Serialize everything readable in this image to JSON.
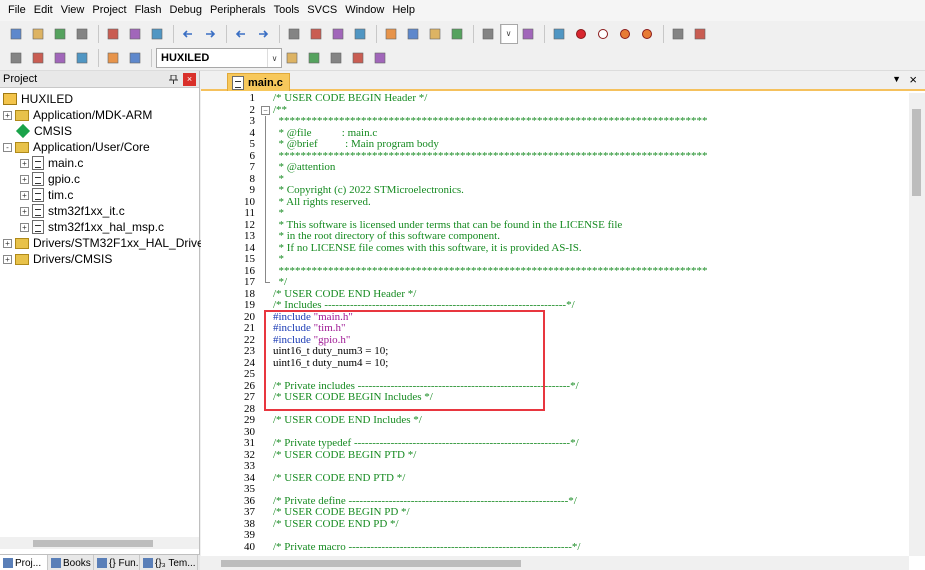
{
  "menu": [
    "File",
    "Edit",
    "View",
    "Project",
    "Flash",
    "Debug",
    "Peripherals",
    "Tools",
    "SVCS",
    "Window",
    "Help"
  ],
  "toolbar2": {
    "target": "HUXILED"
  },
  "project_panel": {
    "title": "Project",
    "pin": "p",
    "close": "×",
    "tree": [
      {
        "label": "HUXILED",
        "kind": "root",
        "level": 0
      },
      {
        "label": "Application/MDK-ARM",
        "kind": "folder",
        "level": 0,
        "exp": "+"
      },
      {
        "label": "CMSIS",
        "kind": "component",
        "level": 0
      },
      {
        "label": "Application/User/Core",
        "kind": "folder",
        "level": 0,
        "exp": "-"
      },
      {
        "label": "main.c",
        "kind": "file",
        "level": 1,
        "exp": "+"
      },
      {
        "label": "gpio.c",
        "kind": "file",
        "level": 1,
        "exp": "+"
      },
      {
        "label": "tim.c",
        "kind": "file",
        "level": 1,
        "exp": "+"
      },
      {
        "label": "stm32f1xx_it.c",
        "kind": "file",
        "level": 1,
        "exp": "+"
      },
      {
        "label": "stm32f1xx_hal_msp.c",
        "kind": "file",
        "level": 1,
        "exp": "+"
      },
      {
        "label": "Drivers/STM32F1xx_HAL_Driver",
        "kind": "folder",
        "level": 0,
        "exp": "+"
      },
      {
        "label": "Drivers/CMSIS",
        "kind": "folder",
        "level": 0,
        "exp": "+"
      }
    ],
    "bottom_tabs": [
      "Proj...",
      "Books",
      "{} Fun...",
      "{}₃ Tem..."
    ]
  },
  "editor": {
    "tab": "main.c",
    "dropdown": "▼",
    "close": "×",
    "lines": [
      {
        "n": "1",
        "fold": "",
        "parts": [
          {
            "t": "/* USER CODE BEGIN Header */",
            "c": "comment"
          }
        ]
      },
      {
        "n": "2",
        "fold": "box",
        "parts": [
          {
            "t": "/**",
            "c": "comment"
          }
        ]
      },
      {
        "n": "3",
        "fold": "line",
        "parts": [
          {
            "t": "  ******************************************************************************",
            "c": "comment"
          }
        ]
      },
      {
        "n": "4",
        "fold": "line",
        "parts": [
          {
            "t": "  * @file           : main.c",
            "c": "comment"
          }
        ]
      },
      {
        "n": "5",
        "fold": "line",
        "parts": [
          {
            "t": "  * @brief          : Main program body",
            "c": "comment"
          }
        ]
      },
      {
        "n": "6",
        "fold": "line",
        "parts": [
          {
            "t": "  ******************************************************************************",
            "c": "comment"
          }
        ]
      },
      {
        "n": "7",
        "fold": "line",
        "parts": [
          {
            "t": "  * @attention",
            "c": "comment"
          }
        ]
      },
      {
        "n": "8",
        "fold": "line",
        "parts": [
          {
            "t": "  *",
            "c": "comment"
          }
        ]
      },
      {
        "n": "9",
        "fold": "line",
        "parts": [
          {
            "t": "  * Copyright (c) 2022 STMicroelectronics.",
            "c": "comment"
          }
        ]
      },
      {
        "n": "10",
        "fold": "line",
        "parts": [
          {
            "t": "  * All rights reserved.",
            "c": "comment"
          }
        ]
      },
      {
        "n": "11",
        "fold": "line",
        "parts": [
          {
            "t": "  *",
            "c": "comment"
          }
        ]
      },
      {
        "n": "12",
        "fold": "line",
        "parts": [
          {
            "t": "  * This software is licensed under terms that can be found in the LICENSE file",
            "c": "comment"
          }
        ]
      },
      {
        "n": "13",
        "fold": "line",
        "parts": [
          {
            "t": "  * in the root directory of this software component.",
            "c": "comment"
          }
        ]
      },
      {
        "n": "14",
        "fold": "line",
        "parts": [
          {
            "t": "  * If no LICENSE file comes with this software, it is provided AS-IS.",
            "c": "comment"
          }
        ]
      },
      {
        "n": "15",
        "fold": "line",
        "parts": [
          {
            "t": "  *",
            "c": "comment"
          }
        ]
      },
      {
        "n": "16",
        "fold": "line",
        "parts": [
          {
            "t": "  ******************************************************************************",
            "c": "comment"
          }
        ]
      },
      {
        "n": "17",
        "fold": "end",
        "parts": [
          {
            "t": "  */",
            "c": "comment"
          }
        ]
      },
      {
        "n": "18",
        "fold": "",
        "parts": [
          {
            "t": "/* USER CODE END Header */",
            "c": "comment"
          }
        ]
      },
      {
        "n": "19",
        "fold": "",
        "parts": [
          {
            "t": "/* Includes ------------------------------------------------------------------*/",
            "c": "comment"
          }
        ]
      },
      {
        "n": "20",
        "fold": "",
        "parts": [
          {
            "t": "#include ",
            "c": "pre"
          },
          {
            "t": "\"main.h\"",
            "c": "str"
          }
        ]
      },
      {
        "n": "21",
        "fold": "",
        "parts": [
          {
            "t": "#include ",
            "c": "pre"
          },
          {
            "t": "\"tim.h\"",
            "c": "str"
          }
        ]
      },
      {
        "n": "22",
        "fold": "",
        "parts": [
          {
            "t": "#include ",
            "c": "pre"
          },
          {
            "t": "\"gpio.h\"",
            "c": "str"
          }
        ]
      },
      {
        "n": "23",
        "fold": "",
        "parts": [
          {
            "t": "uint16_t duty_num3 = 10;",
            "c": "plain"
          }
        ]
      },
      {
        "n": "24",
        "fold": "",
        "parts": [
          {
            "t": "uint16_t duty_num4 = 10;",
            "c": "plain"
          }
        ]
      },
      {
        "n": "25",
        "fold": "",
        "parts": [
          {
            "t": "",
            "c": "plain"
          }
        ]
      },
      {
        "n": "26",
        "fold": "",
        "parts": [
          {
            "t": "/* Private includes ----------------------------------------------------------*/",
            "c": "comment"
          }
        ]
      },
      {
        "n": "27",
        "fold": "",
        "parts": [
          {
            "t": "/* USER CODE BEGIN Includes */",
            "c": "comment"
          }
        ]
      },
      {
        "n": "28",
        "fold": "",
        "parts": [
          {
            "t": "",
            "c": "plain"
          }
        ]
      },
      {
        "n": "29",
        "fold": "",
        "parts": [
          {
            "t": "/* USER CODE END Includes */",
            "c": "comment"
          }
        ]
      },
      {
        "n": "30",
        "fold": "",
        "parts": [
          {
            "t": "",
            "c": "plain"
          }
        ]
      },
      {
        "n": "31",
        "fold": "",
        "parts": [
          {
            "t": "/* Private typedef -----------------------------------------------------------*/",
            "c": "comment"
          }
        ]
      },
      {
        "n": "32",
        "fold": "",
        "parts": [
          {
            "t": "/* USER CODE BEGIN PTD */",
            "c": "comment"
          }
        ]
      },
      {
        "n": "33",
        "fold": "",
        "parts": [
          {
            "t": "",
            "c": "plain"
          }
        ]
      },
      {
        "n": "34",
        "fold": "",
        "parts": [
          {
            "t": "/* USER CODE END PTD */",
            "c": "comment"
          }
        ]
      },
      {
        "n": "35",
        "fold": "",
        "parts": [
          {
            "t": "",
            "c": "plain"
          }
        ]
      },
      {
        "n": "36",
        "fold": "",
        "parts": [
          {
            "t": "/* Private define ------------------------------------------------------------*/",
            "c": "comment"
          }
        ]
      },
      {
        "n": "37",
        "fold": "",
        "parts": [
          {
            "t": "/* USER CODE BEGIN PD */",
            "c": "comment"
          }
        ]
      },
      {
        "n": "38",
        "fold": "",
        "parts": [
          {
            "t": "/* USER CODE END PD */",
            "c": "comment"
          }
        ]
      },
      {
        "n": "39",
        "fold": "",
        "parts": [
          {
            "t": "",
            "c": "plain"
          }
        ]
      },
      {
        "n": "40",
        "fold": "",
        "parts": [
          {
            "t": "/* Private macro -------------------------------------------------------------*/",
            "c": "comment"
          }
        ]
      }
    ]
  },
  "icons": {
    "toolbar1": [
      "new-file-icon",
      "open-icon",
      "save-icon",
      "save-all-icon",
      "cut-icon",
      "copy-icon",
      "paste-icon",
      "undo-icon",
      "redo-icon",
      "nav-back-icon",
      "nav-forward-icon",
      "bookmark-icon",
      "bookmark-prev-icon",
      "bookmark-next-icon",
      "bookmark-clear-icon",
      "indent-icon",
      "unindent-icon",
      "comment-icon",
      "uncomment-icon",
      "find-in-files-icon",
      "find-combo-icon",
      "incremental-find-icon",
      "debug-icon",
      "breakpoint-icon",
      "breakpoint-disable-icon",
      "breakpoint-clear-icon",
      "breakpoint-kill-icon",
      "window-layout-icon",
      "settings-icon"
    ],
    "toolbar2": [
      "translate-icon",
      "build-icon",
      "rebuild-icon",
      "batch-build-icon",
      "stop-build-icon",
      "download-icon",
      "target-options-icon",
      "manage-components-icon",
      "event-recorder-icon",
      "pack-installer-icon",
      "select-packs-icon"
    ]
  },
  "colors": {
    "comment": "#158a20",
    "preprocessor": "#1b3bb5",
    "string": "#a01b96",
    "highlight_box": "#e8363f",
    "tab_accent": "#f7c85c"
  }
}
